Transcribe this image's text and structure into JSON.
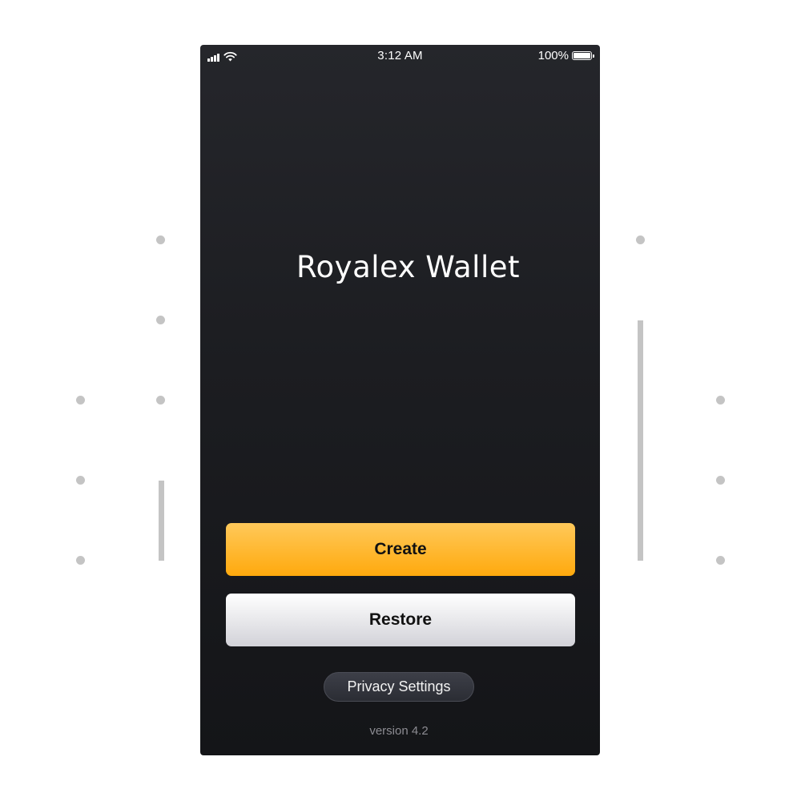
{
  "status_bar": {
    "time": "3:12 AM",
    "battery_percent": "100%",
    "battery_level": 1.0,
    "signal_icon": "cellular-signal-icon",
    "wifi_icon": "wifi-icon",
    "battery_icon": "battery-icon"
  },
  "app": {
    "title": "Royalex Wallet"
  },
  "actions": {
    "create_label": "Create",
    "restore_label": "Restore",
    "privacy_label": "Privacy Settings"
  },
  "footer": {
    "version": "version 4.2"
  },
  "colors": {
    "background": "#1c1d21",
    "accent": "#ffa90d",
    "secondary_button": "#e6e6ea",
    "decor": "#c4c4c4"
  }
}
